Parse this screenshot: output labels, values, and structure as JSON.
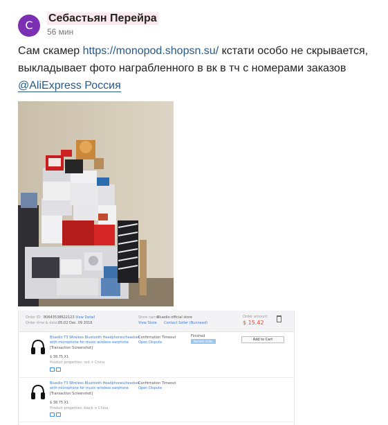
{
  "post": {
    "avatar_letter": "С",
    "author": "Себастьян Перейра",
    "time": "56 мин",
    "text_part1": "Сам скамер ",
    "link": "https://monopod.shopsn.su/",
    "text_part2": " кстати особо не скрывается, выкладывает фото награбленного в вк в тч с номерами заказов ",
    "mention": "@AliExpress Россия"
  },
  "photo": {
    "description_icon": "photo-of-stacked-boxes"
  },
  "order": {
    "order_id_label": "Order ID:",
    "order_id": "80643538622123",
    "view_detail": "View Detail",
    "order_time_label": "Order time & date:",
    "order_time": "05:02 Dec. 09 2016",
    "store_label": "Store name:",
    "store_name": "Bluedio official store",
    "view_store": "View Store",
    "contact_seller": "Contact Seller (Bunnead)",
    "amount_label": "Order amount:",
    "amount": "$ 15.42",
    "items": [
      {
        "title_line1": "Bluedio T3 Wireless Bluetooth Headphones/headset",
        "title_line2": "with microphone for music wireless earphone",
        "snapshot": "[Transaction Screenshot]",
        "price": "$ 38.75 X1",
        "properties": "Product properties: red + China",
        "status": "Confirmation Timeout",
        "dispute": "Open Dispute",
        "finished": "Finished",
        "badge": "Remote Order",
        "add_to_cart": "Add to Cart"
      },
      {
        "title_line1": "Bluedio T3 Wireless Bluetooth Headphones/headset",
        "title_line2": "with microphone for music wireless earphone",
        "snapshot": "[Transaction Screenshot]",
        "price": "$ 38.75 X1",
        "properties": "Product properties: black + China",
        "status": "Confirmation Timeout",
        "dispute": "Open Dispute"
      }
    ]
  },
  "colors": {
    "avatar": "#7b2fb3",
    "link": "#2a5885",
    "price_accent": "#e8472b"
  }
}
